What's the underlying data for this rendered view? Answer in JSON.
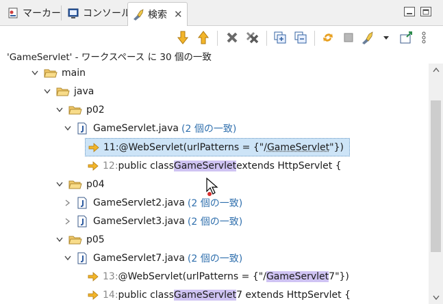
{
  "tabs": [
    {
      "label": "マーカー",
      "icon": "markers-icon"
    },
    {
      "label": "コンソール",
      "icon": "console-icon"
    },
    {
      "label": "検索",
      "icon": "search-flashlight-icon",
      "active": true
    }
  ],
  "toolbar": {
    "buttons": [
      "next-match-icon",
      "previous-match-icon",
      "remove-selected-icon",
      "remove-all-icon",
      "expand-all-icon",
      "collapse-all-icon",
      "refresh-search-icon",
      "cancel-search-icon",
      "search-history-icon",
      "pin-view-icon",
      "view-menu-icon"
    ]
  },
  "status": "'GameServlet' - ワークスペース に 30 個の一致",
  "tree": {
    "main": "main",
    "java": "java",
    "p02": "p02",
    "file1": {
      "name": "GameServlet.java",
      "count": "(2 個の一致)"
    },
    "m1": {
      "lineno": "11:",
      "pre": " @WebServlet(urlPatterns = {\"/",
      "hit": "GameServlet",
      "post": "\"})"
    },
    "m2": {
      "lineno": "12:",
      "pre": " public class ",
      "hit": "GameServlet",
      "post": " extends HttpServlet {"
    },
    "p04": "p04",
    "file2": {
      "name": "GameServlet2.java",
      "count": "(2 個の一致)"
    },
    "file3": {
      "name": "GameServlet3.java",
      "count": "(2 個の一致)"
    },
    "p05": "p05",
    "file4": {
      "name": "GameServlet7.java",
      "count": "(2 個の一致)"
    },
    "m3": {
      "lineno": "13:",
      "pre": " @WebServlet(urlPatterns = {\"/",
      "hit": "GameServlet",
      "post": "7\"})"
    },
    "m4": {
      "lineno": "14:",
      "pre": " public class ",
      "hit": "GameServlet",
      "post": "7 extends HttpServlet {"
    }
  },
  "colors": {
    "accent": "#2f6fad",
    "highlight": "#cfc3f3",
    "selection": "#cde4f7",
    "folder": "#e8b84a",
    "arrow": "#e0a020"
  }
}
